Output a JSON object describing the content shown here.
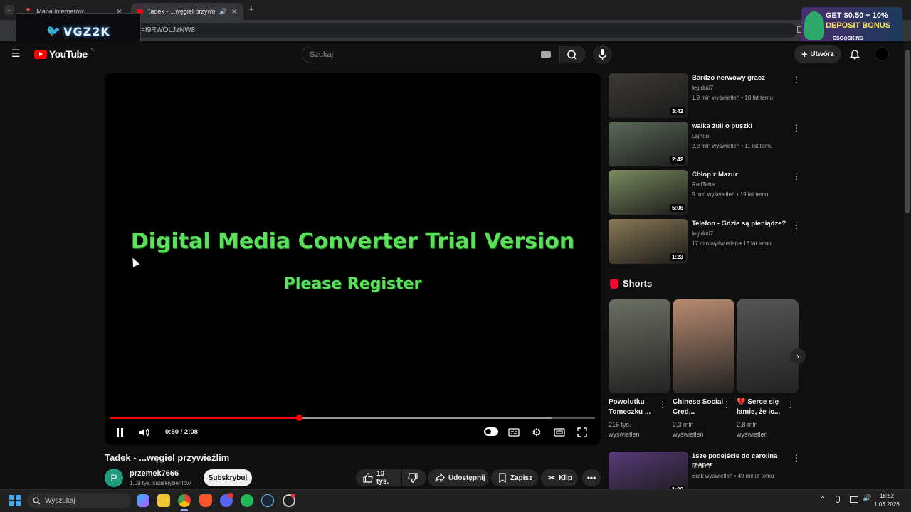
{
  "browser": {
    "tabs": [
      {
        "title": "Mapa internetów",
        "active": false
      },
      {
        "title": "Tadek - ...węgiel przywieźlim",
        "active": true
      }
    ],
    "url_fragment": "=I9RWOLJzNW8"
  },
  "overlay": {
    "logo_text": "VGZ2K"
  },
  "ad": {
    "line1": "GET $0.50 + 10%",
    "line2": "DEPOSIT BONUS",
    "brand": "CSG⊙SKINS"
  },
  "header": {
    "logo": "YouTube",
    "country": "PL",
    "search_placeholder": "Szukaj",
    "create_label": "Utwórz"
  },
  "player": {
    "watermark_line1": "Digital Media Converter Trial Version",
    "watermark_line2": "Please Register",
    "current_time": "0:50",
    "duration": "2:08",
    "progress_fraction": 0.39,
    "buffered_fraction": 0.91,
    "timecode": "0:50 / 2:08"
  },
  "video": {
    "title": "Tadek - ...węgiel przywieźlim",
    "channel": "przemek7666",
    "channel_initial": "P",
    "subscribers": "1,09 tys. subskrybentów",
    "subscribe_label": "Subskrybuj",
    "likes": "10 tys.",
    "share_label": "Udostępnij",
    "save_label": "Zapisz",
    "clip_label": "Klip"
  },
  "recommendations": [
    {
      "title": "Bardzo nerwowy gracz",
      "channel": "legidud7",
      "meta": "1,9 mln wyświetleń • 18 lat temu",
      "duration": "3:42",
      "color": "#3d3a36"
    },
    {
      "title": "walka żuli o puszki",
      "channel": "Lajhoo",
      "meta": "2,8 mln wyświetleń • 11 lat temu",
      "duration": "2:42",
      "color": "#5c6b5a"
    },
    {
      "title": "Chłop z Mazur",
      "channel": "RadTaba",
      "meta": "5 mln wyświetleń • 19 lat temu",
      "duration": "5:06",
      "color": "#7a8b5e"
    },
    {
      "title": "Telefon - Gdzie są pieniądze?",
      "channel": "legidud7",
      "meta": "17 mln wyświetleń • 18 lat temu",
      "duration": "1:23",
      "color": "#8a7a55"
    },
    {
      "title": "1sze podejście do carolina reaper",
      "channel": "nxithvn",
      "meta": "Brak wyświetleń • 49 minut temu",
      "duration": "1:26",
      "color": "#5a3a7a"
    }
  ],
  "shorts": {
    "heading": "Shorts",
    "items": [
      {
        "title": "Powolutku Tomeczku ...",
        "views": "216 tys.",
        "views_unit": "wyświetleń",
        "color": "#6b6f62"
      },
      {
        "title": "Chinese Social Cred...",
        "views": "2,3 mln",
        "views_unit": "wyświetleń",
        "color": "#b88a70"
      },
      {
        "title": "💔 Serce się łamie, że ic...",
        "views": "2,8 mln",
        "views_unit": "wyświetleń",
        "color": "#555555"
      }
    ]
  },
  "taskbar": {
    "search_label": "Wyszukaj",
    "time": "18:52",
    "date": "1.03.2026"
  }
}
